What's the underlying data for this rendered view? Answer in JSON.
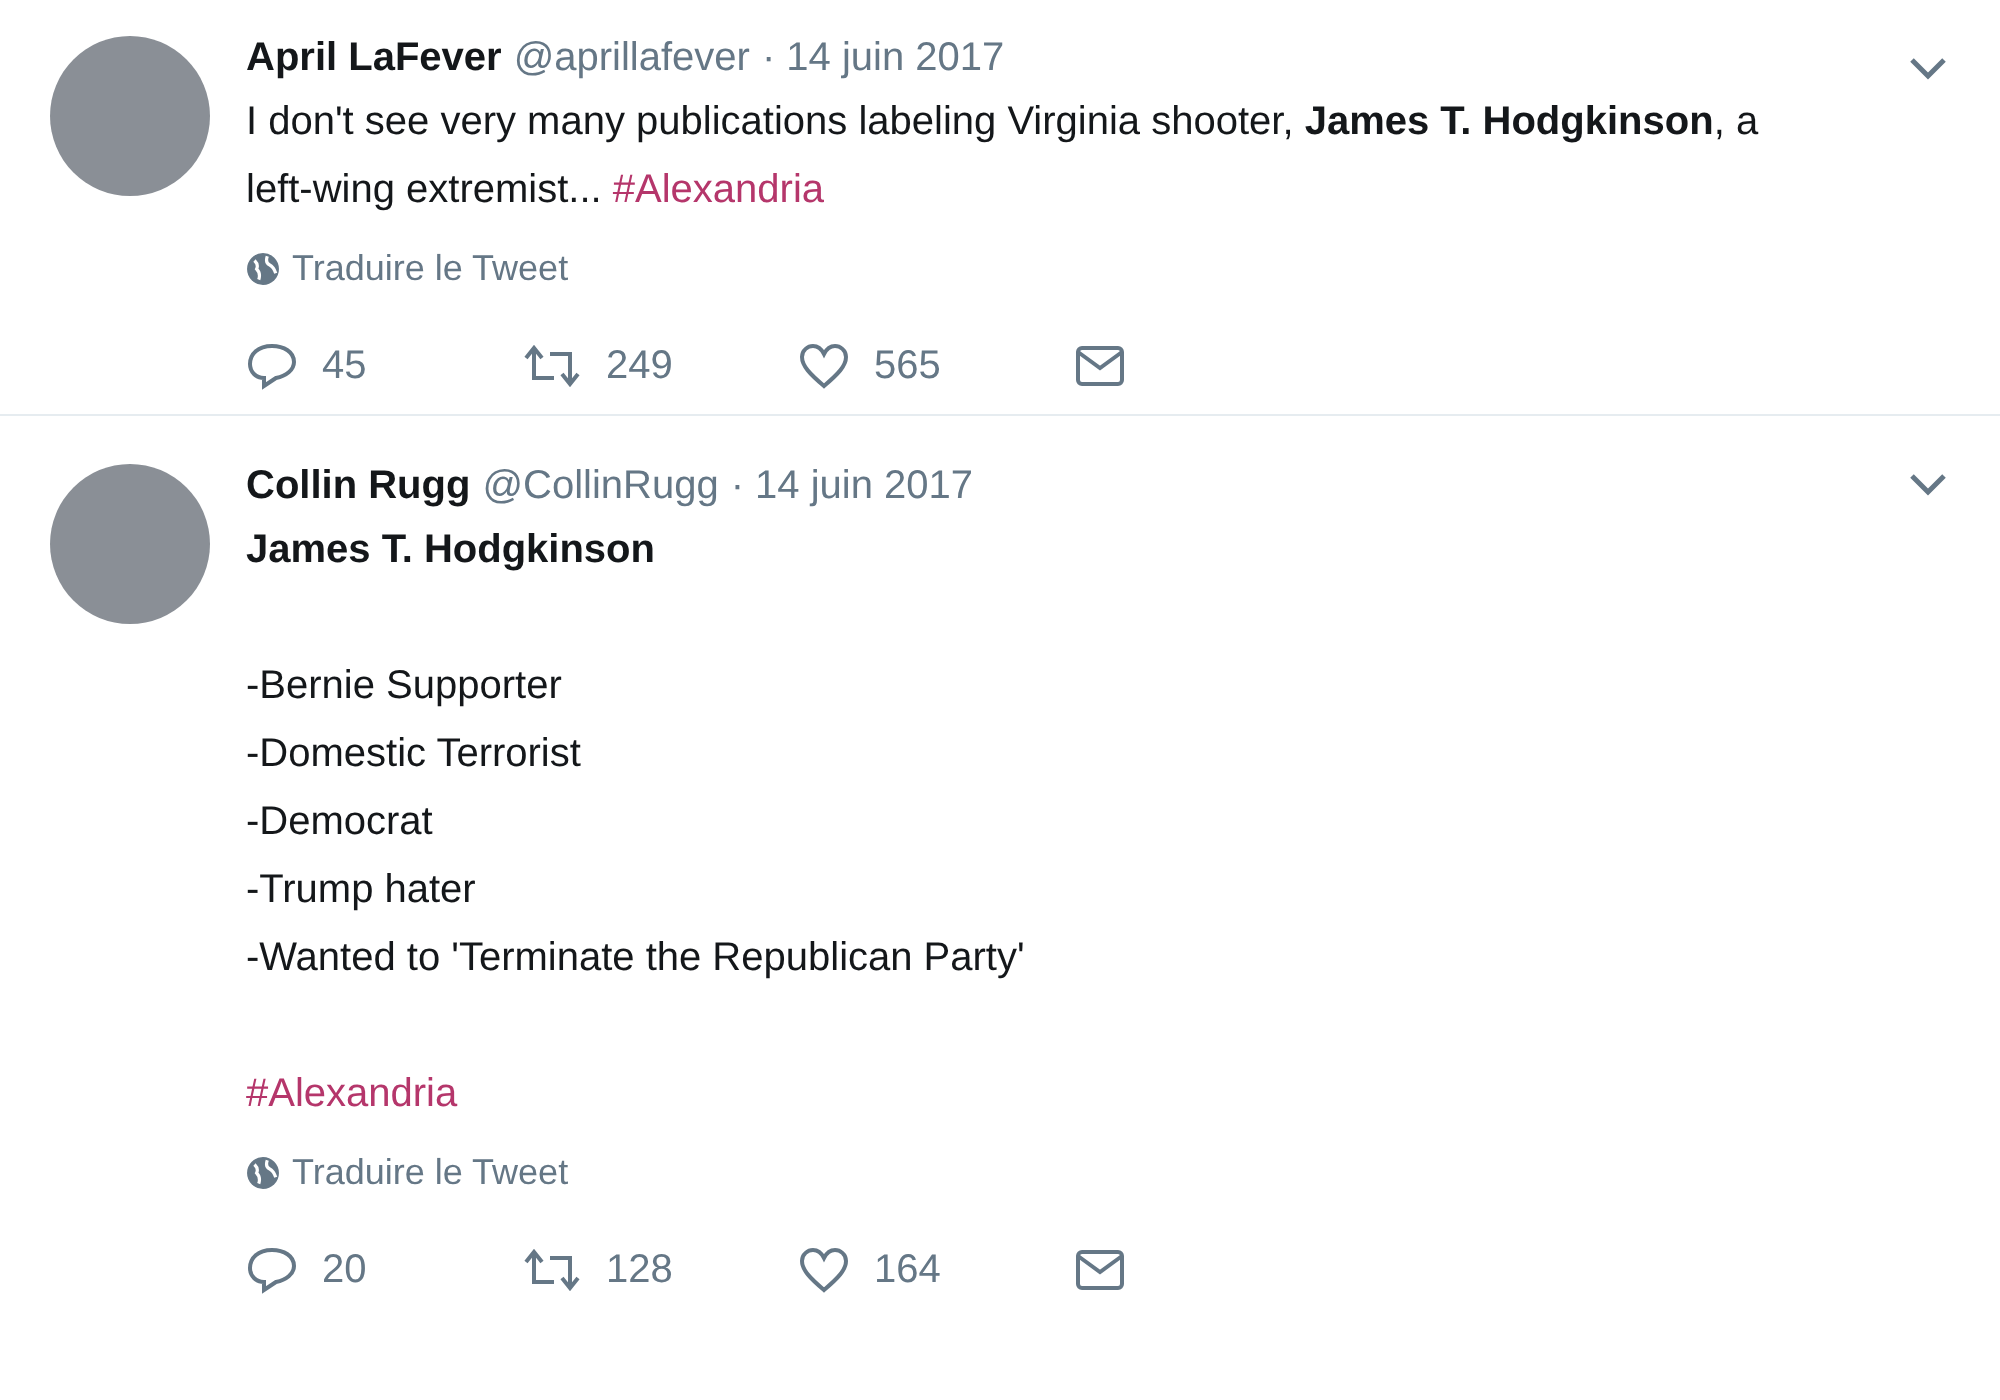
{
  "tweets": [
    {
      "name": "April LaFever",
      "handle": "@aprillafever",
      "date": "· 14 juin 2017",
      "paragraphs": [
        {
          "kind": "text",
          "text": "I don't see very many publications labeling Virginia shooter, **James T. Hodgkinson**, a left-wing extremist...",
          "hashtag": "#Alexandria"
        }
      ],
      "translate": "Traduire le Tweet",
      "actions": [
        {
          "kind": "reply",
          "count": "45"
        },
        {
          "kind": "retweet",
          "count": "249"
        },
        {
          "kind": "like",
          "count": "565"
        },
        {
          "kind": "message"
        }
      ]
    },
    {
      "name": "Collin Rugg",
      "handle": "@CollinRugg",
      "date": "· 14 juin 2017",
      "paragraphs": [
        {
          "kind": "bold",
          "lines": [
            "James T. Hodgkinson"
          ]
        },
        {
          "kind": "lines",
          "lines": [
            "-Bernie Supporter",
            "-Domestic Terrorist",
            "-Democrat",
            "-Trump hater",
            "-Wanted to 'Terminate the Republican Party'"
          ]
        },
        {
          "kind": "hashtag",
          "lines": [
            "#Alexandria"
          ]
        }
      ],
      "translate": "Traduire le Tweet",
      "actions": [
        {
          "kind": "reply",
          "count": "20"
        },
        {
          "kind": "retweet",
          "count": "128"
        },
        {
          "kind": "like",
          "count": "164"
        },
        {
          "kind": "message"
        }
      ]
    }
  ]
}
